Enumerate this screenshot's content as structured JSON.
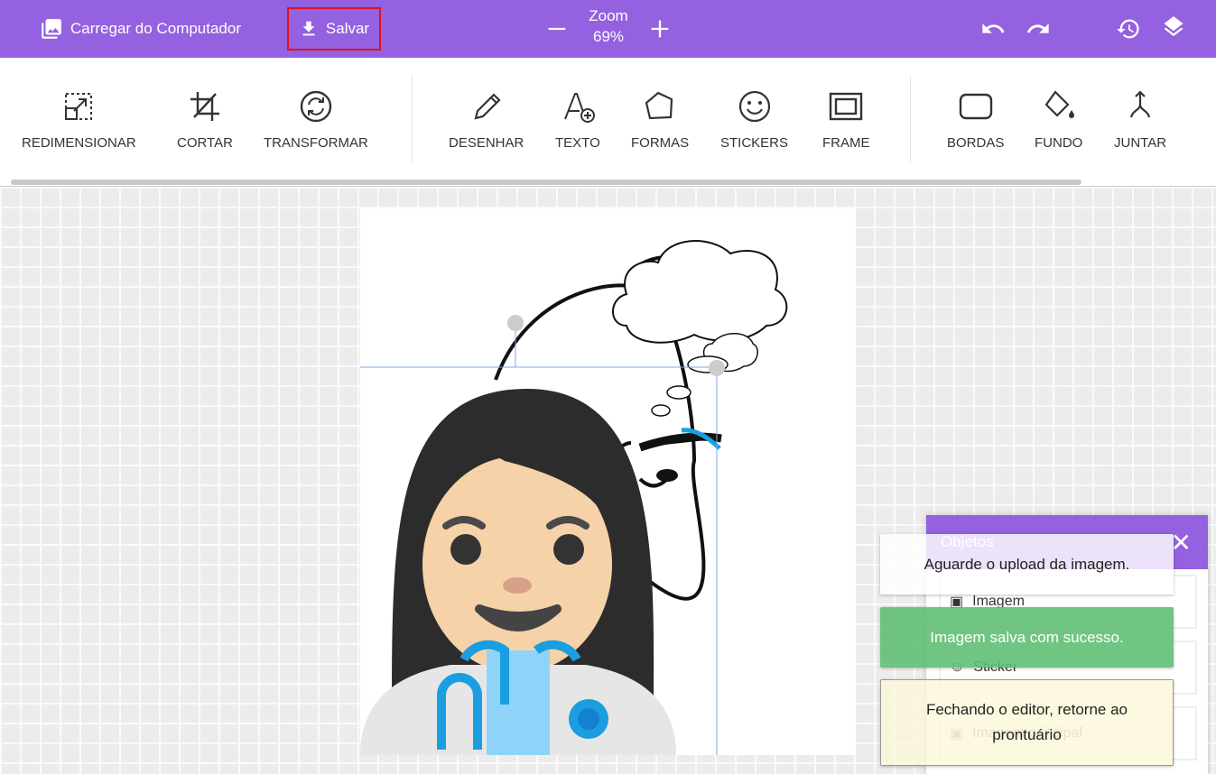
{
  "topbar": {
    "upload_label": "Carregar do Computador",
    "save_label": "Salvar",
    "zoom_label": "Zoom",
    "zoom_value": "69%"
  },
  "tools": [
    {
      "label": "REDIMENSIONAR"
    },
    {
      "label": "CORTAR"
    },
    {
      "label": "TRANSFORMAR"
    },
    {
      "label": "DESENHAR"
    },
    {
      "label": "TEXTO"
    },
    {
      "label": "FORMAS"
    },
    {
      "label": "STICKERS"
    },
    {
      "label": "FRAME"
    },
    {
      "label": "BORDAS"
    },
    {
      "label": "FUNDO"
    },
    {
      "label": "JUNTAR"
    }
  ],
  "objects_panel": {
    "title": "Objetos",
    "items": [
      {
        "label": "Imagem"
      },
      {
        "label": "Sticker"
      },
      {
        "label": "Imagem principal"
      }
    ]
  },
  "toasts": [
    {
      "text": "Aguarde o upload da imagem.",
      "color": "#ffffff"
    },
    {
      "text": "Imagem salva com sucesso.",
      "color": "#62bf76"
    },
    {
      "text": "Fechando o editor, retorne ao prontuário",
      "color": "#fcf7da"
    }
  ],
  "colors": {
    "brand": "#9461e0",
    "highlight": "#e0101a"
  }
}
